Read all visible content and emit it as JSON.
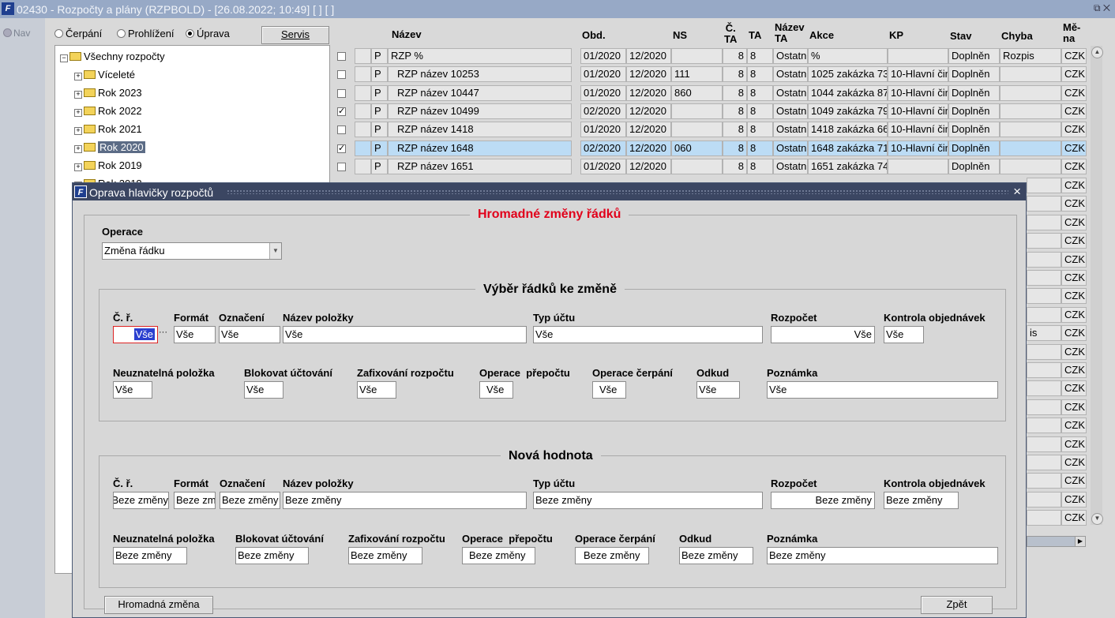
{
  "window": {
    "title": "02430 - Rozpočty a plány (RZPBOLD) - [26.08.2022; 10:49]  [ ]  [ ]",
    "controls": "⧉ ✕"
  },
  "nav": {
    "label": "Nav"
  },
  "modes": [
    {
      "label": "Čerpání",
      "selected": false
    },
    {
      "label": "Prohlížení",
      "selected": false
    },
    {
      "label": "Úprava",
      "selected": true
    }
  ],
  "servis_label": "Servis",
  "tree": {
    "root": "Všechny rozpočty",
    "items": [
      "Víceleté",
      "Rok 2023",
      "Rok 2022",
      "Rok 2021",
      "Rok 2020",
      "Rok 2019",
      "Rok 2018"
    ],
    "selected": "Rok 2020"
  },
  "grid": {
    "headers": {
      "nazev": "Název",
      "obd": "Obd.",
      "ns": "NS",
      "cta1": "Č.",
      "cta2": "TA",
      "ta": "TA",
      "nazevta1": "Název",
      "nazevta2": "TA",
      "akce": "Akce",
      "kp": "KP",
      "stav": "Stav",
      "chyba": "Chyba",
      "mena1": "Mě-",
      "mena2": "na"
    },
    "rows": [
      {
        "checked": false,
        "p": "P",
        "nazev": "RZP %",
        "od": "01/2020",
        "do": "12/2020",
        "ns": "",
        "cta": "8",
        "ta": "8",
        "nazevta": "Ostatn",
        "akce": "%",
        "kp": "",
        "stav": "Doplněn",
        "chyba": "Rozpis",
        "mena": "CZK",
        "selected": false
      },
      {
        "checked": false,
        "p": "P",
        "nazev": "RZP název 10253",
        "od": "01/2020",
        "do": "12/2020",
        "ns": "111",
        "cta": "8",
        "ta": "8",
        "nazevta": "Ostatn",
        "akce": "1025 zakázka 73",
        "kp": "10-Hlavní čin",
        "stav": "Doplněn",
        "chyba": "",
        "mena": "CZK",
        "selected": false
      },
      {
        "checked": false,
        "p": "P",
        "nazev": "RZP název 10447",
        "od": "01/2020",
        "do": "12/2020",
        "ns": "860",
        "cta": "8",
        "ta": "8",
        "nazevta": "Ostatn",
        "akce": "1044 zakázka 87",
        "kp": "10-Hlavní čin",
        "stav": "Doplněn",
        "chyba": "",
        "mena": "CZK",
        "selected": false
      },
      {
        "checked": true,
        "p": "P",
        "nazev": "RZP název 10499",
        "od": "02/2020",
        "do": "12/2020",
        "ns": "",
        "cta": "8",
        "ta": "8",
        "nazevta": "Ostatn",
        "akce": "1049 zakázka 79",
        "kp": "10-Hlavní čin",
        "stav": "Doplněn",
        "chyba": "",
        "mena": "CZK",
        "selected": false
      },
      {
        "checked": false,
        "p": "P",
        "nazev": "RZP název 1418",
        "od": "01/2020",
        "do": "12/2020",
        "ns": "",
        "cta": "8",
        "ta": "8",
        "nazevta": "Ostatn",
        "akce": "1418 zakázka 66",
        "kp": "10-Hlavní čin",
        "stav": "Doplněn",
        "chyba": "",
        "mena": "CZK",
        "selected": false
      },
      {
        "checked": true,
        "p": "P",
        "nazev": "RZP název 1648",
        "od": "02/2020",
        "do": "12/2020",
        "ns": "060",
        "cta": "8",
        "ta": "8",
        "nazevta": "Ostatn",
        "akce": "1648 zakázka 71",
        "kp": "10-Hlavní čin",
        "stav": "Doplněn",
        "chyba": "",
        "mena": "CZK",
        "selected": true
      },
      {
        "checked": false,
        "p": "P",
        "nazev": "RZP název 1651",
        "od": "01/2020",
        "do": "12/2020",
        "ns": "",
        "cta": "8",
        "ta": "8",
        "nazevta": "Ostatn",
        "akce": "1651 zakázka 74",
        "kp": "",
        "stav": "Doplněn",
        "chyba": "",
        "mena": "CZK",
        "selected": false
      }
    ],
    "hidden_rows_chyba": [
      "",
      "",
      "",
      "",
      "",
      "",
      "",
      "",
      "is",
      "",
      "",
      "",
      "",
      "",
      "",
      "",
      "",
      "",
      ""
    ],
    "hidden_rows_mena": "CZK"
  },
  "modal": {
    "title": "Oprava hlavičky rozpočtů",
    "heading": "Hromadné změny řádků",
    "operace_label": "Operace",
    "operace_value": "Změna řádku",
    "select_title": "Výběr řádků ke změně",
    "new_title": "Nová hodnota",
    "labels": {
      "cr": "Č. ř.",
      "format": "Formát",
      "oznaceni": "Označení",
      "nazev": "Název položky",
      "typ": "Typ účtu",
      "rozpocet": "Rozpočet",
      "kontrola": "Kontrola objednávek",
      "neuzn": "Neuznatelná položka",
      "blok": "Blokovat účtování",
      "zafix": "Zafixování rozpočtu",
      "prepocet": "Operace  přepočtu",
      "cerpani": "Operace čerpání",
      "odkud": "Odkud",
      "poznamka": "Poznámka"
    },
    "select_values": {
      "cr": "Vše",
      "format": "Vše",
      "oznaceni": "Vše",
      "nazev": "Vše",
      "typ": "Vše",
      "rozpocet": "Vše",
      "kontrola": "Vše",
      "neuzn": "Vše",
      "blok": "Vše",
      "zafix": "Vše",
      "prepocet": "Vše",
      "cerpani": "Vše",
      "odkud": "Vše",
      "poznamka": "Vše"
    },
    "new_values": {
      "cr": "Beze změny",
      "format": "Beze změny",
      "oznaceni": "Beze změny",
      "nazev": "Beze změny",
      "typ": "Beze změny",
      "rozpocet": "Beze změny",
      "kontrola": "Beze změny",
      "neuzn": "Beze změny",
      "blok": "Beze změny",
      "zafix": "Beze změny",
      "prepocet": "Beze změny",
      "cerpani": "Beze změny",
      "odkud": "Beze změny",
      "poznamka": "Beze změny"
    },
    "apply_label": "Hromadná změna",
    "back_label": "Zpět"
  }
}
